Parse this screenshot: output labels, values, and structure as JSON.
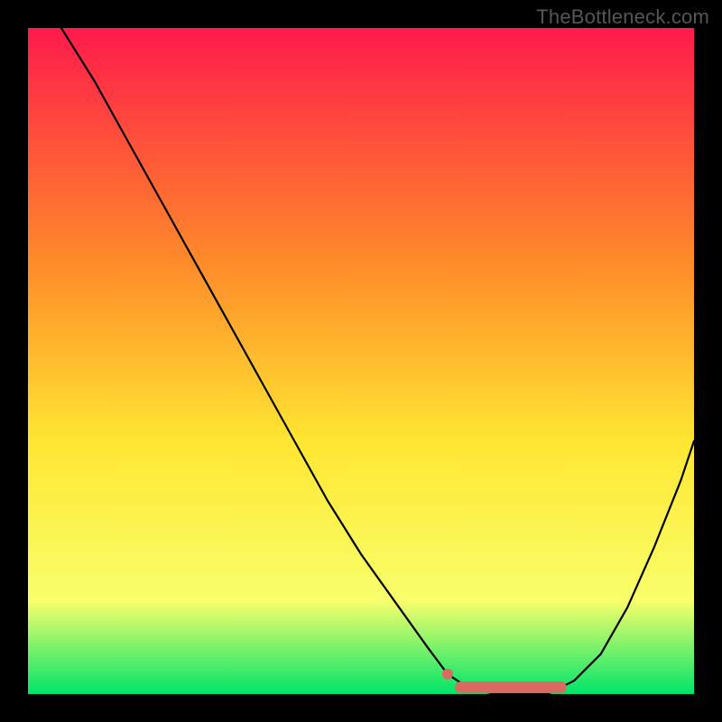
{
  "watermark": "TheBottleneck.com",
  "colors": {
    "gradient_top": "#ff1a4b",
    "gradient_mid1": "#ff8a2a",
    "gradient_mid2": "#ffe631",
    "gradient_mid3": "#f8ff6b",
    "gradient_bottom": "#00e46a",
    "frame": "#000000",
    "curve": "#000000",
    "marker": "#d86a62"
  },
  "chart_data": {
    "type": "line",
    "title": "",
    "xlabel": "",
    "ylabel": "",
    "xlim": [
      0,
      100
    ],
    "ylim": [
      0,
      100
    ],
    "grid": false,
    "legend": false,
    "series": [
      {
        "name": "bottleneck-curve",
        "x": [
          5,
          10,
          15,
          20,
          25,
          30,
          35,
          40,
          45,
          50,
          55,
          60,
          63,
          66,
          70,
          74,
          78,
          82,
          86,
          90,
          94,
          98,
          100
        ],
        "y": [
          100,
          92,
          83,
          74,
          65,
          56,
          47,
          38,
          29,
          21,
          14,
          7,
          3,
          1,
          0,
          0,
          0,
          2,
          6,
          13,
          22,
          32,
          38
        ]
      }
    ],
    "markers": [
      {
        "name": "valley-start-dot",
        "x": 63,
        "y": 3
      },
      {
        "name": "valley-band-start",
        "x": 65,
        "y": 1
      },
      {
        "name": "valley-band-end",
        "x": 80,
        "y": 1
      }
    ]
  }
}
